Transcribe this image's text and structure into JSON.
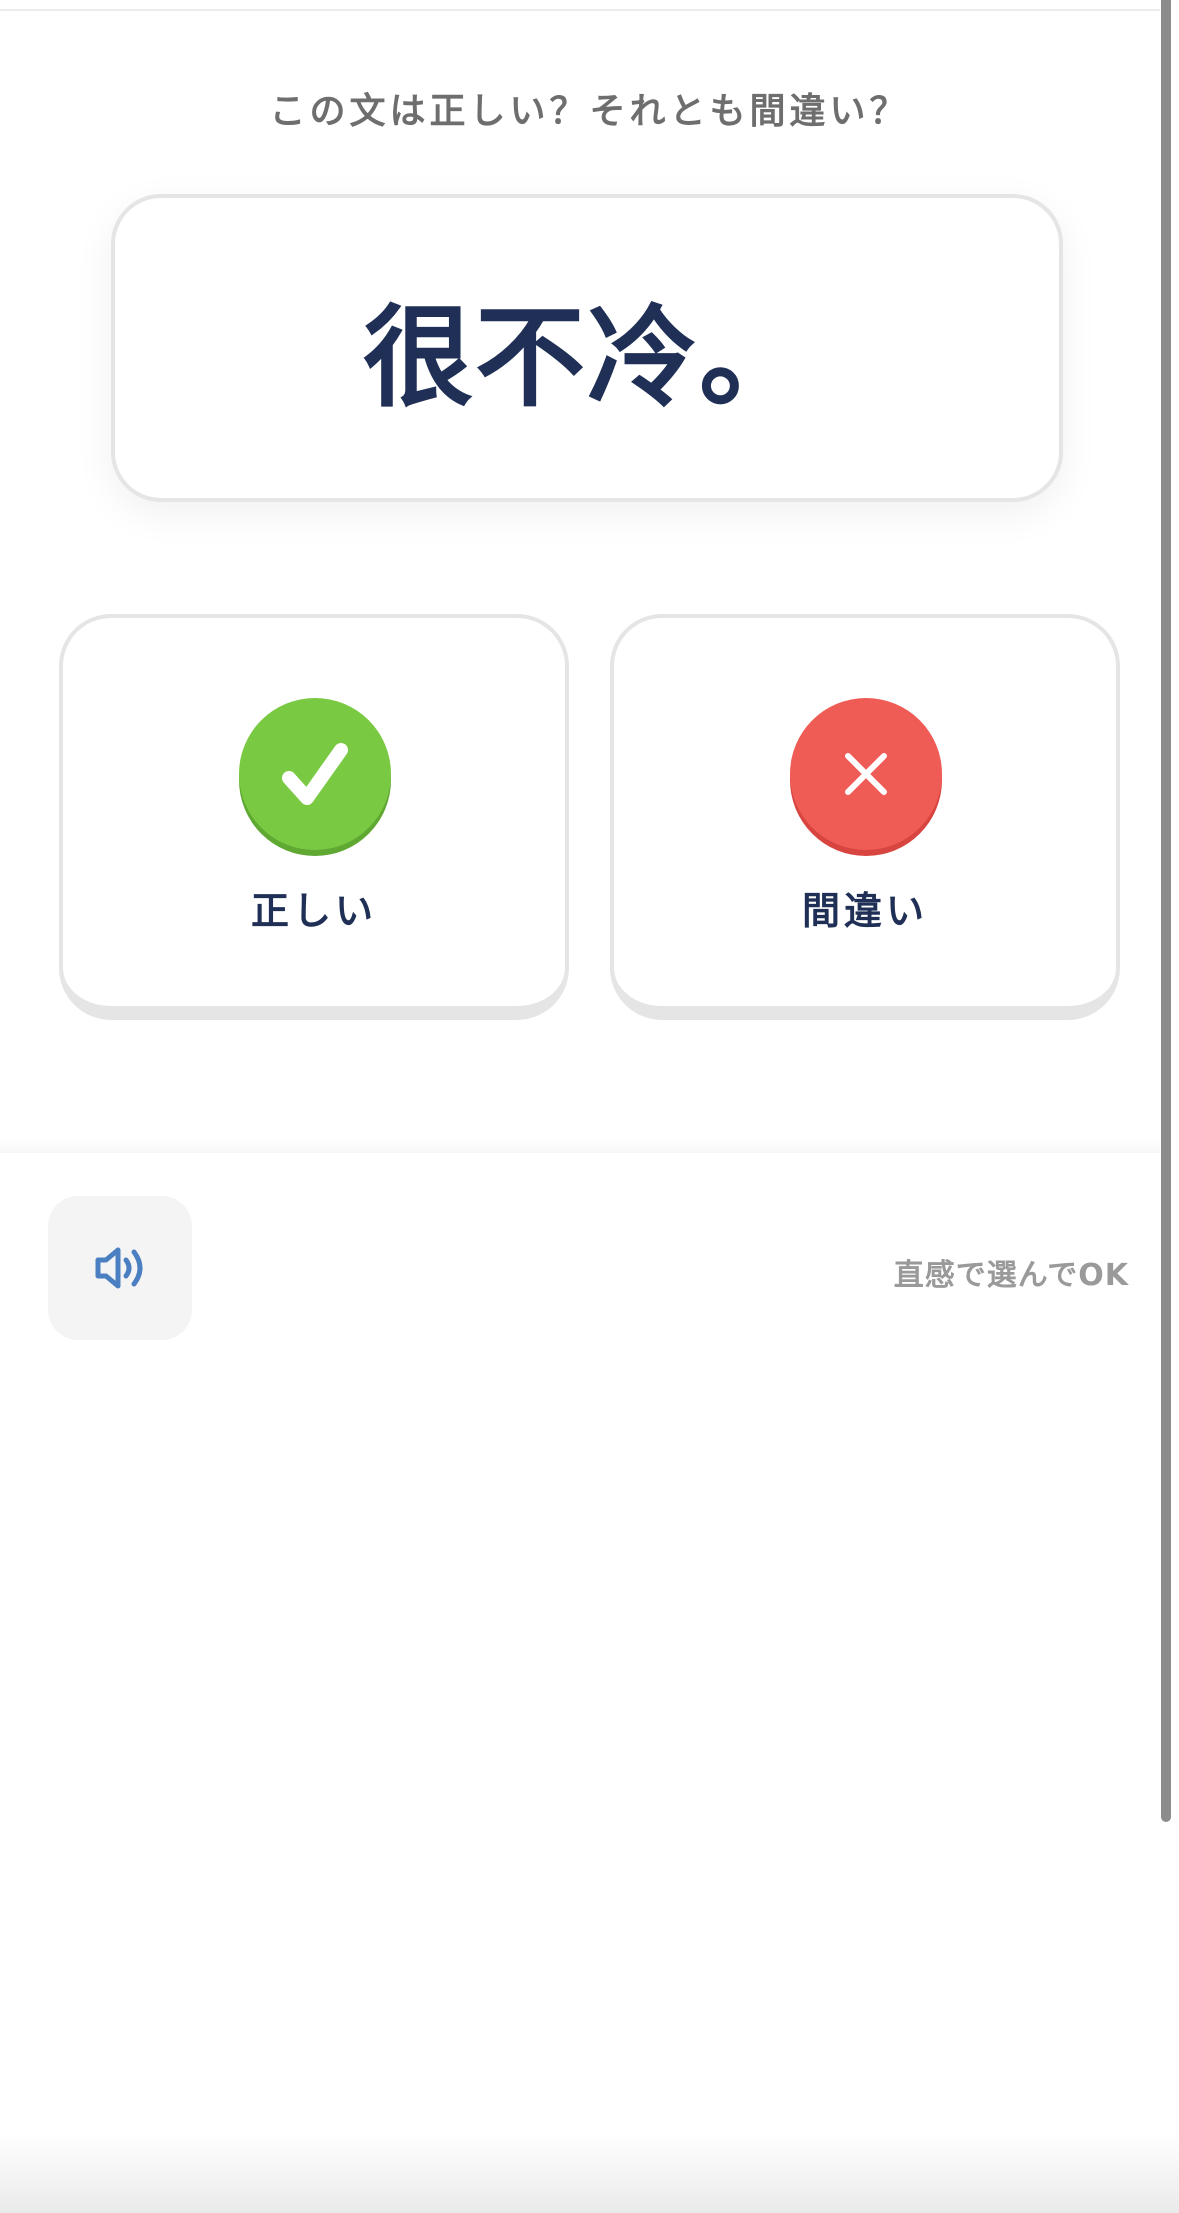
{
  "prompt": "この文は正しい？それとも間違い？",
  "sentence": "很不冷。",
  "answers": {
    "correct": {
      "label": "正しい",
      "icon": "check-icon",
      "color": "#7ac943"
    },
    "wrong": {
      "label": "間違い",
      "icon": "x-icon",
      "color": "#ef5b55"
    }
  },
  "footer": {
    "sound_icon": "speaker-icon",
    "hint": "直感で選んでOK"
  },
  "colors": {
    "text_primary": "#1f2f55",
    "text_secondary": "#6e6e6e",
    "border": "#e5e5e5",
    "speaker_blue": "#4a7fc1"
  }
}
